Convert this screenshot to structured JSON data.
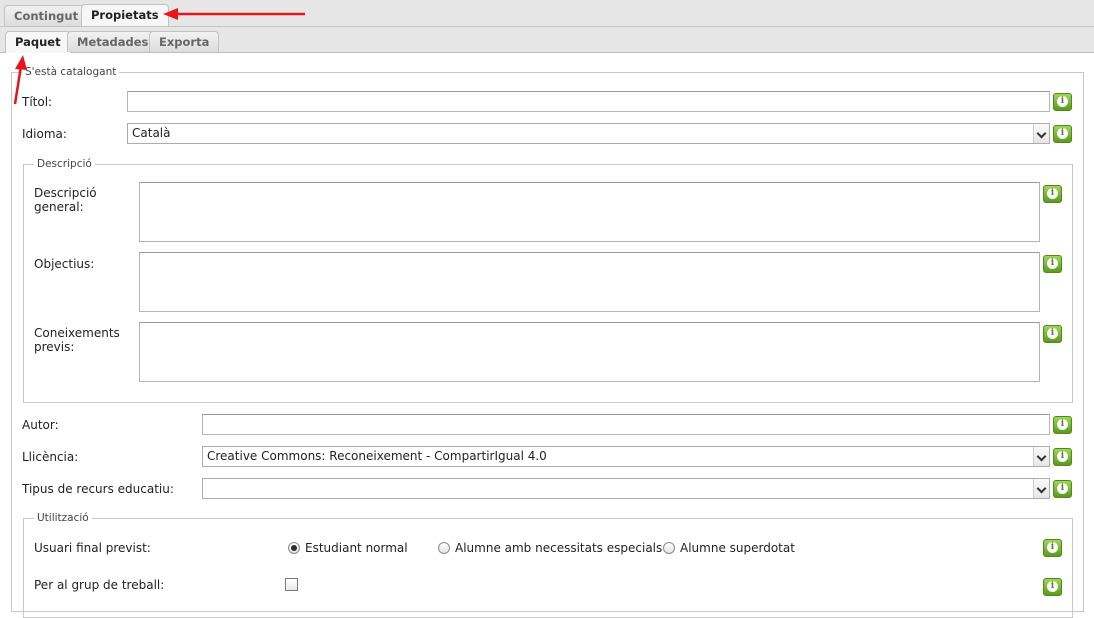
{
  "tabs_top": [
    {
      "label": "Contingut",
      "active": false
    },
    {
      "label": "Propietats",
      "active": true
    }
  ],
  "tabs_sub": [
    {
      "label": "Paquet",
      "active": true
    },
    {
      "label": "Metadades",
      "active": false
    },
    {
      "label": "Exporta",
      "active": false
    }
  ],
  "cataloging": {
    "legend": "S'està catalogant",
    "title_label": "Títol:",
    "title_value": "",
    "language_label": "Idioma:",
    "language_value": "Català",
    "description": {
      "legend": "Descripció",
      "general_label_1": "Descripció",
      "general_label_2": "general:",
      "objectives_label": "Objectius:",
      "prior_label_1": "Coneixements",
      "prior_label_2": "previs:"
    },
    "author_label": "Autor:",
    "author_value": "",
    "license_label": "Llicència:",
    "license_value": "Creative Commons: Reconeixement - CompartirIgual 4.0",
    "resource_type_label": "Tipus de recurs educatiu:",
    "resource_type_value": "",
    "usage": {
      "legend": "Utilització",
      "user_label": "Usuari final previst:",
      "user_options": [
        {
          "label": "Estudiant normal",
          "checked": true
        },
        {
          "label": "Alumne amb necessitats especials",
          "checked": false
        },
        {
          "label": "Alumne superdotat",
          "checked": false
        }
      ],
      "group_label": "Per al grup de treball:",
      "group_checked": false
    }
  },
  "colors": {
    "annotation_arrow": "#e8161b",
    "info_button": "#6aaa2a"
  }
}
